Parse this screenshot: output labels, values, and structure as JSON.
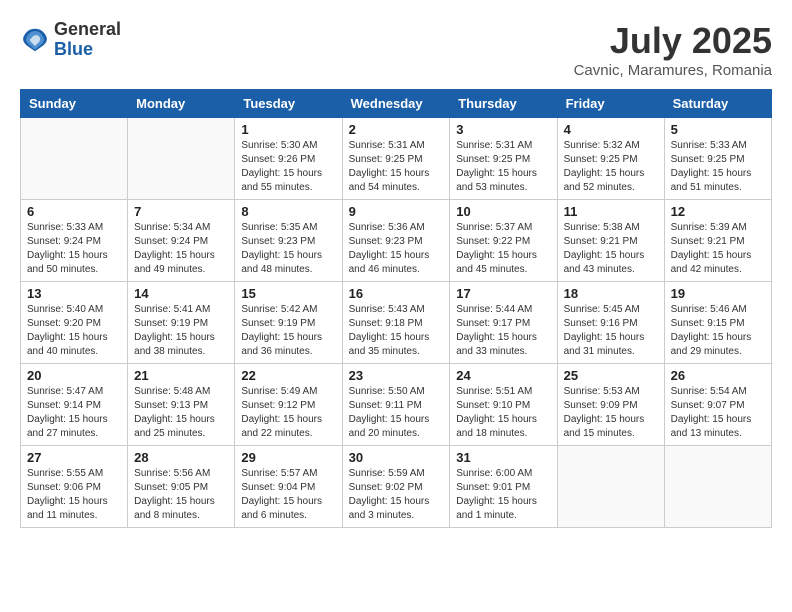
{
  "header": {
    "logo": {
      "general": "General",
      "blue": "Blue"
    },
    "month_year": "July 2025",
    "location": "Cavnic, Maramures, Romania"
  },
  "weekdays": [
    "Sunday",
    "Monday",
    "Tuesday",
    "Wednesday",
    "Thursday",
    "Friday",
    "Saturday"
  ],
  "weeks": [
    [
      {
        "day": "",
        "sunrise": "",
        "sunset": "",
        "daylight": ""
      },
      {
        "day": "",
        "sunrise": "",
        "sunset": "",
        "daylight": ""
      },
      {
        "day": "1",
        "sunrise": "Sunrise: 5:30 AM",
        "sunset": "Sunset: 9:26 PM",
        "daylight": "Daylight: 15 hours and 55 minutes."
      },
      {
        "day": "2",
        "sunrise": "Sunrise: 5:31 AM",
        "sunset": "Sunset: 9:25 PM",
        "daylight": "Daylight: 15 hours and 54 minutes."
      },
      {
        "day": "3",
        "sunrise": "Sunrise: 5:31 AM",
        "sunset": "Sunset: 9:25 PM",
        "daylight": "Daylight: 15 hours and 53 minutes."
      },
      {
        "day": "4",
        "sunrise": "Sunrise: 5:32 AM",
        "sunset": "Sunset: 9:25 PM",
        "daylight": "Daylight: 15 hours and 52 minutes."
      },
      {
        "day": "5",
        "sunrise": "Sunrise: 5:33 AM",
        "sunset": "Sunset: 9:25 PM",
        "daylight": "Daylight: 15 hours and 51 minutes."
      }
    ],
    [
      {
        "day": "6",
        "sunrise": "Sunrise: 5:33 AM",
        "sunset": "Sunset: 9:24 PM",
        "daylight": "Daylight: 15 hours and 50 minutes."
      },
      {
        "day": "7",
        "sunrise": "Sunrise: 5:34 AM",
        "sunset": "Sunset: 9:24 PM",
        "daylight": "Daylight: 15 hours and 49 minutes."
      },
      {
        "day": "8",
        "sunrise": "Sunrise: 5:35 AM",
        "sunset": "Sunset: 9:23 PM",
        "daylight": "Daylight: 15 hours and 48 minutes."
      },
      {
        "day": "9",
        "sunrise": "Sunrise: 5:36 AM",
        "sunset": "Sunset: 9:23 PM",
        "daylight": "Daylight: 15 hours and 46 minutes."
      },
      {
        "day": "10",
        "sunrise": "Sunrise: 5:37 AM",
        "sunset": "Sunset: 9:22 PM",
        "daylight": "Daylight: 15 hours and 45 minutes."
      },
      {
        "day": "11",
        "sunrise": "Sunrise: 5:38 AM",
        "sunset": "Sunset: 9:21 PM",
        "daylight": "Daylight: 15 hours and 43 minutes."
      },
      {
        "day": "12",
        "sunrise": "Sunrise: 5:39 AM",
        "sunset": "Sunset: 9:21 PM",
        "daylight": "Daylight: 15 hours and 42 minutes."
      }
    ],
    [
      {
        "day": "13",
        "sunrise": "Sunrise: 5:40 AM",
        "sunset": "Sunset: 9:20 PM",
        "daylight": "Daylight: 15 hours and 40 minutes."
      },
      {
        "day": "14",
        "sunrise": "Sunrise: 5:41 AM",
        "sunset": "Sunset: 9:19 PM",
        "daylight": "Daylight: 15 hours and 38 minutes."
      },
      {
        "day": "15",
        "sunrise": "Sunrise: 5:42 AM",
        "sunset": "Sunset: 9:19 PM",
        "daylight": "Daylight: 15 hours and 36 minutes."
      },
      {
        "day": "16",
        "sunrise": "Sunrise: 5:43 AM",
        "sunset": "Sunset: 9:18 PM",
        "daylight": "Daylight: 15 hours and 35 minutes."
      },
      {
        "day": "17",
        "sunrise": "Sunrise: 5:44 AM",
        "sunset": "Sunset: 9:17 PM",
        "daylight": "Daylight: 15 hours and 33 minutes."
      },
      {
        "day": "18",
        "sunrise": "Sunrise: 5:45 AM",
        "sunset": "Sunset: 9:16 PM",
        "daylight": "Daylight: 15 hours and 31 minutes."
      },
      {
        "day": "19",
        "sunrise": "Sunrise: 5:46 AM",
        "sunset": "Sunset: 9:15 PM",
        "daylight": "Daylight: 15 hours and 29 minutes."
      }
    ],
    [
      {
        "day": "20",
        "sunrise": "Sunrise: 5:47 AM",
        "sunset": "Sunset: 9:14 PM",
        "daylight": "Daylight: 15 hours and 27 minutes."
      },
      {
        "day": "21",
        "sunrise": "Sunrise: 5:48 AM",
        "sunset": "Sunset: 9:13 PM",
        "daylight": "Daylight: 15 hours and 25 minutes."
      },
      {
        "day": "22",
        "sunrise": "Sunrise: 5:49 AM",
        "sunset": "Sunset: 9:12 PM",
        "daylight": "Daylight: 15 hours and 22 minutes."
      },
      {
        "day": "23",
        "sunrise": "Sunrise: 5:50 AM",
        "sunset": "Sunset: 9:11 PM",
        "daylight": "Daylight: 15 hours and 20 minutes."
      },
      {
        "day": "24",
        "sunrise": "Sunrise: 5:51 AM",
        "sunset": "Sunset: 9:10 PM",
        "daylight": "Daylight: 15 hours and 18 minutes."
      },
      {
        "day": "25",
        "sunrise": "Sunrise: 5:53 AM",
        "sunset": "Sunset: 9:09 PM",
        "daylight": "Daylight: 15 hours and 15 minutes."
      },
      {
        "day": "26",
        "sunrise": "Sunrise: 5:54 AM",
        "sunset": "Sunset: 9:07 PM",
        "daylight": "Daylight: 15 hours and 13 minutes."
      }
    ],
    [
      {
        "day": "27",
        "sunrise": "Sunrise: 5:55 AM",
        "sunset": "Sunset: 9:06 PM",
        "daylight": "Daylight: 15 hours and 11 minutes."
      },
      {
        "day": "28",
        "sunrise": "Sunrise: 5:56 AM",
        "sunset": "Sunset: 9:05 PM",
        "daylight": "Daylight: 15 hours and 8 minutes."
      },
      {
        "day": "29",
        "sunrise": "Sunrise: 5:57 AM",
        "sunset": "Sunset: 9:04 PM",
        "daylight": "Daylight: 15 hours and 6 minutes."
      },
      {
        "day": "30",
        "sunrise": "Sunrise: 5:59 AM",
        "sunset": "Sunset: 9:02 PM",
        "daylight": "Daylight: 15 hours and 3 minutes."
      },
      {
        "day": "31",
        "sunrise": "Sunrise: 6:00 AM",
        "sunset": "Sunset: 9:01 PM",
        "daylight": "Daylight: 15 hours and 1 minute."
      },
      {
        "day": "",
        "sunrise": "",
        "sunset": "",
        "daylight": ""
      },
      {
        "day": "",
        "sunrise": "",
        "sunset": "",
        "daylight": ""
      }
    ]
  ]
}
